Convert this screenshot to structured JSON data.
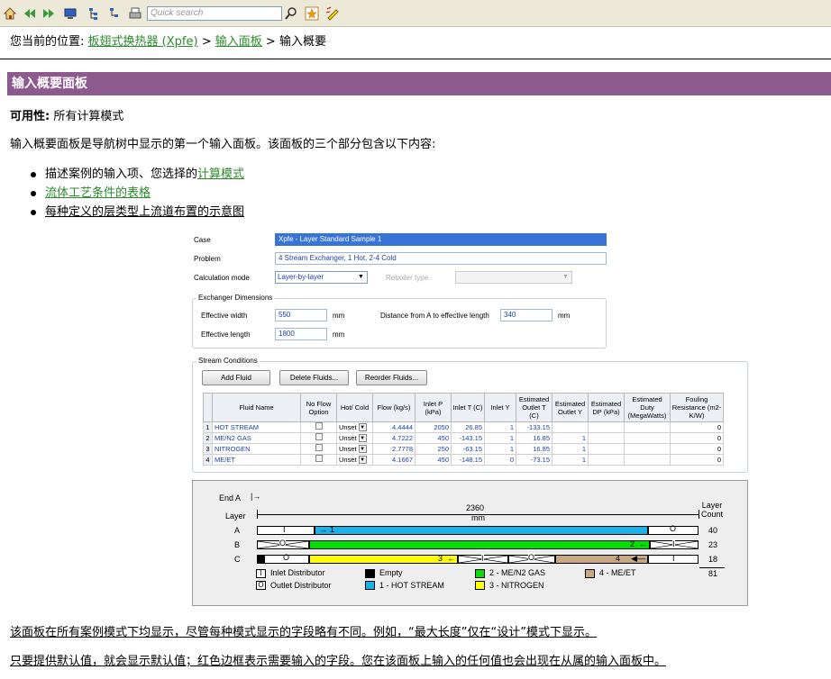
{
  "toolbar": {
    "search_placeholder": "Quick search"
  },
  "breadcrumb": {
    "prefix": "您当前的位置:",
    "link1": "板翅式换热器 (Xpfe)",
    "sep1": ">",
    "link2": "输入面板",
    "sep2": ">",
    "current": "输入概要"
  },
  "heading": "输入概要面板",
  "availability": {
    "label": "可用性:",
    "value": "所有计算模式"
  },
  "intro": "输入概要面板是导航树中显示的第一个输入面板。该面板的三个部分包含以下内容:",
  "bullets": [
    {
      "text": "描述案例的输入项、您选择的",
      "link": "计算模式"
    },
    {
      "link": "流体工艺条件的表格"
    },
    {
      "text": "每种定义的层类型上流道布置的示意图"
    }
  ],
  "form": {
    "case_label": "Case",
    "case_value": "Xpfe - Layer Standard Sample 1",
    "problem_label": "Problem",
    "problem_value": "4 Stream Exchanger, 1 Hot, 2-4 Cold",
    "calc_label": "Calculation mode",
    "calc_value": "Layer-by-layer",
    "reboiler_label": "Reboiler type",
    "reboiler_value": "",
    "dims_title": "Exchanger Dimensions",
    "width_label": "Effective width",
    "width_value": "550",
    "width_unit": "mm",
    "length_label": "Effective length",
    "length_value": "1800",
    "length_unit": "mm",
    "dist_label": "Distance from A to effective length",
    "dist_value": "340",
    "dist_unit": "mm",
    "streams_title": "Stream Conditions",
    "add_btn": "Add Fluid",
    "delete_btn": "Delete Fluids...",
    "reorder_btn": "Reorder Fluids...",
    "columns": [
      "Fluid Name",
      "No Flow Option",
      "Hot/ Cold",
      "Flow (kg/s)",
      "Inlet P (kPa)",
      "Inlet T (C)",
      "Inlet Y",
      "Estimated Outlet T (C)",
      "Estimated Outlet Y",
      "Estimated DP (kPa)",
      "Estimated Duty (MegaWatts)",
      "Fouling Resistance (m2-K/W)"
    ],
    "rows": [
      {
        "n": "1",
        "name": "HOT STREAM",
        "hc": "Unset",
        "flow": "4.4444",
        "p": "2050",
        "t": "26.85",
        "y": "1",
        "ot": "-133.15",
        "oy": "",
        "dp": "",
        "duty": "",
        "fr": "0"
      },
      {
        "n": "2",
        "name": "ME/N2 GAS",
        "hc": "Unset",
        "flow": "4.7222",
        "p": "450",
        "t": "-143.15",
        "y": "1",
        "ot": "16.85",
        "oy": "1",
        "dp": "",
        "duty": "",
        "fr": "0"
      },
      {
        "n": "3",
        "name": "NITROGEN",
        "hc": "Unset",
        "flow": "2.7778",
        "p": "250",
        "t": "-63.15",
        "y": "1",
        "ot": "16.85",
        "oy": "1",
        "dp": "",
        "duty": "",
        "fr": "0"
      },
      {
        "n": "4",
        "name": "ME/ET",
        "hc": "Unset",
        "flow": "4.1667",
        "p": "450",
        "t": "-148.15",
        "y": "0",
        "ot": "-73.15",
        "oy": "1",
        "dp": "",
        "duty": "",
        "fr": "0"
      }
    ]
  },
  "diagram": {
    "end_label": "End A",
    "layer_label": "Layer",
    "length": "2360",
    "unit": "mm",
    "count_label": "Layer Count",
    "layers": [
      {
        "name": "A",
        "count": "40",
        "stream": "1"
      },
      {
        "name": "B",
        "count": "23",
        "stream": "2"
      },
      {
        "name": "C",
        "count": "18",
        "stream": "3",
        "stream2": "4"
      }
    ],
    "total": "81",
    "legend": {
      "inlet": "Inlet Distributor",
      "outlet": "Outlet Distributor",
      "empty": "Empty",
      "s1": "1 - HOT STREAM",
      "s2": "2 - ME/N2 GAS",
      "s3": "3 - NITROGEN",
      "s4": "4 - ME/ET"
    },
    "colors": {
      "hot": "#1ab0e8",
      "men2": "#00e000",
      "nitrogen": "#ffff00",
      "meet": "#c8a882",
      "empty": "#000000"
    }
  },
  "notes": [
    "该面板在所有案例模式下均显示，尽管每种模式显示的字段略有不同。例如，“最大长度”仅在“设计”模式下显示。",
    "只要提供默认值，就会显示默认值；红色边框表示需要输入的字段。您在该面板上输入的任何值也会出现在从属的输入面板中。"
  ]
}
